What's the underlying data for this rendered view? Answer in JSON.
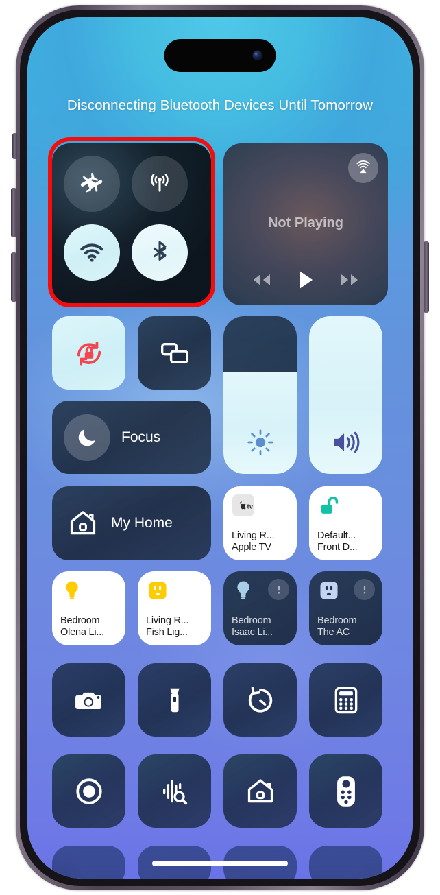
{
  "device": {
    "name": "iPhone 14 Pro",
    "frame_color": "#6b5f72",
    "screen_background_top": "#46c3e6",
    "screen_background_bottom": "#6a73e6"
  },
  "annotation": {
    "highlight_color": "#f50d0d",
    "highlight_target": "connectivity-module"
  },
  "control_center": {
    "header_text": "Disconnecting Bluetooth Devices Until Tomorrow",
    "connectivity": {
      "module_name": "connectivity",
      "toggles": [
        {
          "id": "airplane-mode",
          "icon": "airplane-icon",
          "state": "off"
        },
        {
          "id": "cellular-data",
          "icon": "cellular-icon",
          "state": "off"
        },
        {
          "id": "wifi",
          "icon": "wifi-icon",
          "state": "on"
        },
        {
          "id": "bluetooth",
          "icon": "bluetooth-icon",
          "state": "on"
        }
      ]
    },
    "media": {
      "title": "Not Playing",
      "airplay_icon": "airplay-icon",
      "controls": [
        {
          "id": "rewind",
          "icon": "rewind-icon"
        },
        {
          "id": "play",
          "icon": "play-icon"
        },
        {
          "id": "forward",
          "icon": "forward-icon"
        }
      ]
    },
    "quick_toggles": [
      {
        "id": "rotation-lock",
        "icon": "rotation-lock-icon",
        "state": "on",
        "accent": "#f2454f"
      },
      {
        "id": "screen-mirroring",
        "icon": "screen-mirroring-icon",
        "state": "off"
      }
    ],
    "focus": {
      "label": "Focus",
      "icon": "moon-icon",
      "state": "off"
    },
    "sliders": [
      {
        "id": "brightness",
        "icon": "brightness-icon",
        "value": 65,
        "icon_color": "#5c8ece"
      },
      {
        "id": "volume",
        "icon": "volume-icon",
        "value": 100,
        "icon_color": "#4a4f9e"
      }
    ],
    "home": {
      "my_home_label": "My Home",
      "my_home_icon": "house-icon",
      "scenes": [
        {
          "id": "apple-tv",
          "icon": "appletv-icon",
          "line1": "Living R...",
          "line2": "Apple TV",
          "state": "on"
        },
        {
          "id": "front-door-lock",
          "icon": "unlocked-padlock-icon",
          "line1": "Default...",
          "line2": "Front D...",
          "state": "on",
          "accent": "#13c2a5"
        }
      ],
      "accessories": [
        {
          "id": "bedroom-olena-light",
          "icon": "lightbulb-icon",
          "line1": "Bedroom",
          "line2": "Olena Li...",
          "state": "on",
          "accent": "#ffcc00",
          "warning": false
        },
        {
          "id": "living-room-fish-light",
          "icon": "outlet-icon",
          "line1": "Living R...",
          "line2": "Fish Lig...",
          "state": "on",
          "accent": "#ffcc00",
          "warning": false
        },
        {
          "id": "bedroom-isaac-light",
          "icon": "lightbulb-icon",
          "line1": "Bedroom",
          "line2": "Isaac Li...",
          "state": "off",
          "warning": true
        },
        {
          "id": "bedroom-the-ac",
          "icon": "outlet-icon",
          "line1": "Bedroom",
          "line2": "The AC",
          "state": "off",
          "warning": true
        }
      ]
    },
    "utilities_row_1": [
      {
        "id": "camera",
        "icon": "camera-icon"
      },
      {
        "id": "flashlight",
        "icon": "flashlight-icon"
      },
      {
        "id": "timer",
        "icon": "timer-icon"
      },
      {
        "id": "calculator",
        "icon": "calculator-icon"
      }
    ],
    "utilities_row_2": [
      {
        "id": "screen-record",
        "icon": "screen-record-icon"
      },
      {
        "id": "sound-recognition",
        "icon": "sound-recognition-icon"
      },
      {
        "id": "home",
        "icon": "house-outline-icon"
      },
      {
        "id": "apple-tv-remote",
        "icon": "remote-icon"
      }
    ]
  }
}
